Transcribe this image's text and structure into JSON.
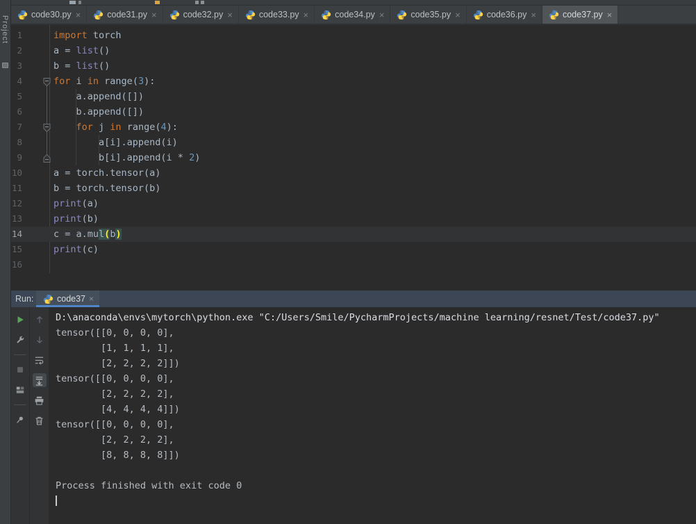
{
  "colors": {
    "editor_bg": "#2b2b2b",
    "panel_bg": "#3c3f41",
    "toolbar_bg": "#313335",
    "active_tab_bg": "#515557",
    "run_header_bg": "#3c4654",
    "run_tab_underline": "#4d85c6",
    "keyword": "#cc7832",
    "builtin": "#8888c6",
    "number": "#6897bb",
    "code_text": "#a9b7c6",
    "line_number": "#606366",
    "current_line_bg": "#323334",
    "brace_match": "#ffef28",
    "brace_match_bg": "#3b514d",
    "run_green": "#5ba35b"
  },
  "project_sidebar": {
    "label": "Project"
  },
  "editor_tabs": {
    "close_glyph": "×",
    "file_icon": "python-icon",
    "tabs": [
      {
        "label": "code30.py"
      },
      {
        "label": "code31.py"
      },
      {
        "label": "code32.py"
      },
      {
        "label": "code33.py"
      },
      {
        "label": "code34.py"
      },
      {
        "label": "code35.py"
      },
      {
        "label": "code36.py"
      },
      {
        "label": "code37.py",
        "active": true
      }
    ]
  },
  "editor": {
    "lines": [
      {
        "n": "1",
        "tokens": [
          [
            "kw",
            "import"
          ],
          [
            "pl",
            " torch"
          ]
        ]
      },
      {
        "n": "2",
        "tokens": [
          [
            "pl",
            "a = "
          ],
          [
            "bi",
            "list"
          ],
          [
            "pl",
            "()"
          ]
        ]
      },
      {
        "n": "3",
        "tokens": [
          [
            "pl",
            "b = "
          ],
          [
            "bi",
            "list"
          ],
          [
            "pl",
            "()"
          ]
        ]
      },
      {
        "n": "4",
        "fold": "down",
        "tokens": [
          [
            "kw",
            "for"
          ],
          [
            "pl",
            " i "
          ],
          [
            "kw",
            "in"
          ],
          [
            "pl",
            " range("
          ],
          [
            "num",
            "3"
          ],
          [
            "pl",
            "):"
          ]
        ]
      },
      {
        "n": "5",
        "tokens": [
          [
            "pl",
            "    a.append([])"
          ]
        ]
      },
      {
        "n": "6",
        "tokens": [
          [
            "pl",
            "    b.append([])"
          ]
        ]
      },
      {
        "n": "7",
        "fold": "down",
        "tokens": [
          [
            "pl",
            "    "
          ],
          [
            "kw",
            "for"
          ],
          [
            "pl",
            " j "
          ],
          [
            "kw",
            "in"
          ],
          [
            "pl",
            " range("
          ],
          [
            "num",
            "4"
          ],
          [
            "pl",
            "):"
          ]
        ]
      },
      {
        "n": "8",
        "tokens": [
          [
            "pl",
            "        a[i].append(i)"
          ]
        ]
      },
      {
        "n": "9",
        "fold": "up",
        "tokens": [
          [
            "pl",
            "        b[i].append(i * "
          ],
          [
            "num",
            "2"
          ],
          [
            "pl",
            ")"
          ]
        ]
      },
      {
        "n": "10",
        "tokens": [
          [
            "pl",
            "a = torch.tensor(a)"
          ]
        ]
      },
      {
        "n": "11",
        "tokens": [
          [
            "pl",
            "b = torch.tensor(b)"
          ]
        ]
      },
      {
        "n": "12",
        "tokens": [
          [
            "bi",
            "print"
          ],
          [
            "pl",
            "(a)"
          ]
        ]
      },
      {
        "n": "13",
        "tokens": [
          [
            "bi",
            "print"
          ],
          [
            "pl",
            "(b)"
          ]
        ]
      },
      {
        "n": "14",
        "current": true,
        "tokens": [
          [
            "pl",
            "c = a.mu"
          ],
          [
            "hlg",
            "l"
          ],
          [
            "brc",
            "("
          ],
          [
            "pl",
            "b"
          ],
          [
            "brc",
            ")"
          ]
        ]
      },
      {
        "n": "15",
        "tokens": [
          [
            "bi",
            "print"
          ],
          [
            "pl",
            "(c)"
          ]
        ]
      },
      {
        "n": "16",
        "tokens": []
      }
    ]
  },
  "run_panel": {
    "label": "Run:",
    "tab": {
      "label": "code37",
      "close_glyph": "×",
      "icon": "python-icon"
    },
    "run_toolbar": [
      {
        "name": "rerun-button",
        "icon": "play-icon"
      },
      {
        "name": "edit-configuration-button",
        "icon": "wrench-icon"
      },
      {
        "sep": true
      },
      {
        "name": "stop-button",
        "icon": "stop-icon",
        "disabled": true
      },
      {
        "name": "restore-layout-button",
        "icon": "layout-icon"
      },
      {
        "sep": true
      },
      {
        "name": "pin-tab-button",
        "icon": "pin-icon"
      }
    ],
    "console_toolbar": [
      {
        "name": "up-the-stack-button",
        "icon": "arrow-up-icon",
        "disabled": true
      },
      {
        "name": "down-the-stack-button",
        "icon": "arrow-down-icon",
        "disabled": true
      },
      {
        "name": "soft-wrap-button",
        "icon": "soft-wrap-icon"
      },
      {
        "name": "scroll-to-end-button",
        "icon": "scroll-to-end-icon",
        "selected": true
      },
      {
        "name": "print-button",
        "icon": "printer-icon"
      },
      {
        "name": "clear-all-button",
        "icon": "trash-icon"
      }
    ],
    "console": {
      "command": "D:\\anaconda\\envs\\mytorch\\python.exe \"C:/Users/Smile/PycharmProjects/machine learning/resnet/Test/code37.py\"",
      "output": [
        "tensor([[0, 0, 0, 0],",
        "        [1, 1, 1, 1],",
        "        [2, 2, 2, 2]])",
        "tensor([[0, 0, 0, 0],",
        "        [2, 2, 2, 2],",
        "        [4, 4, 4, 4]])",
        "tensor([[0, 0, 0, 0],",
        "        [2, 2, 2, 2],",
        "        [8, 8, 8, 8]])",
        "",
        "Process finished with exit code 0"
      ]
    }
  }
}
